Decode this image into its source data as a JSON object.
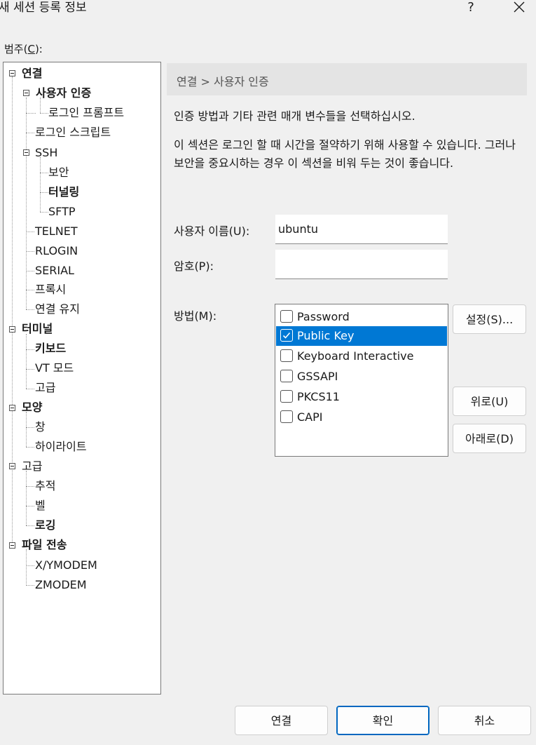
{
  "window": {
    "title": "새 세션 등록 정보",
    "help_label": "?"
  },
  "category_label_prefix": "범주(",
  "category_label_key": "C",
  "category_label_suffix": "):",
  "tree": {
    "connection": "연결",
    "user_auth": "사용자 인증",
    "login_prompt": "로그인 프롬프트",
    "login_script": "로그인 스크립트",
    "ssh": "SSH",
    "security": "보안",
    "tunneling": "터널링",
    "sftp": "SFTP",
    "telnet": "TELNET",
    "rlogin": "RLOGIN",
    "serial": "SERIAL",
    "proxy": "프록시",
    "keepalive": "연결 유지",
    "terminal": "터미널",
    "keyboard": "키보드",
    "vt_mode": "VT 모드",
    "terminal_advanced": "고급",
    "appearance": "모양",
    "window": "창",
    "highlight": "하이라이트",
    "advanced": "고급",
    "trace": "추적",
    "bell": "벨",
    "logging": "로깅",
    "file_transfer": "파일 전송",
    "xymodem": "X/YMODEM",
    "zmodem": "ZMODEM"
  },
  "breadcrumb": {
    "parent": "연결",
    "separator": ">",
    "current": "사용자 인증"
  },
  "description": {
    "line1": "인증 방법과 기타 관련 매개 변수들을 선택하십시오.",
    "line2": "이 섹션은 로그인 할 때 시간을 절약하기 위해 사용할 수 있습니다. 그러나 보안을 중요시하는 경우 이 섹션을 비워 두는 것이 좋습니다."
  },
  "form": {
    "username_label": "사용자 이름(U):",
    "username_value": "ubuntu",
    "password_label": "암호(P):",
    "password_value": "",
    "method_label": "방법(M):"
  },
  "methods": [
    {
      "label": "Password",
      "checked": false,
      "selected": false
    },
    {
      "label": "Public Key",
      "checked": true,
      "selected": true
    },
    {
      "label": "Keyboard Interactive",
      "checked": false,
      "selected": false
    },
    {
      "label": "GSSAPI",
      "checked": false,
      "selected": false
    },
    {
      "label": "PKCS11",
      "checked": false,
      "selected": false
    },
    {
      "label": "CAPI",
      "checked": false,
      "selected": false
    }
  ],
  "buttons": {
    "settings": "설정(S)...",
    "up": "위로(U)",
    "down": "아래로(D)",
    "connect": "연결",
    "ok": "확인",
    "cancel": "취소"
  },
  "colors": {
    "selection": "#0078d4",
    "primary_border": "#0067c0"
  }
}
